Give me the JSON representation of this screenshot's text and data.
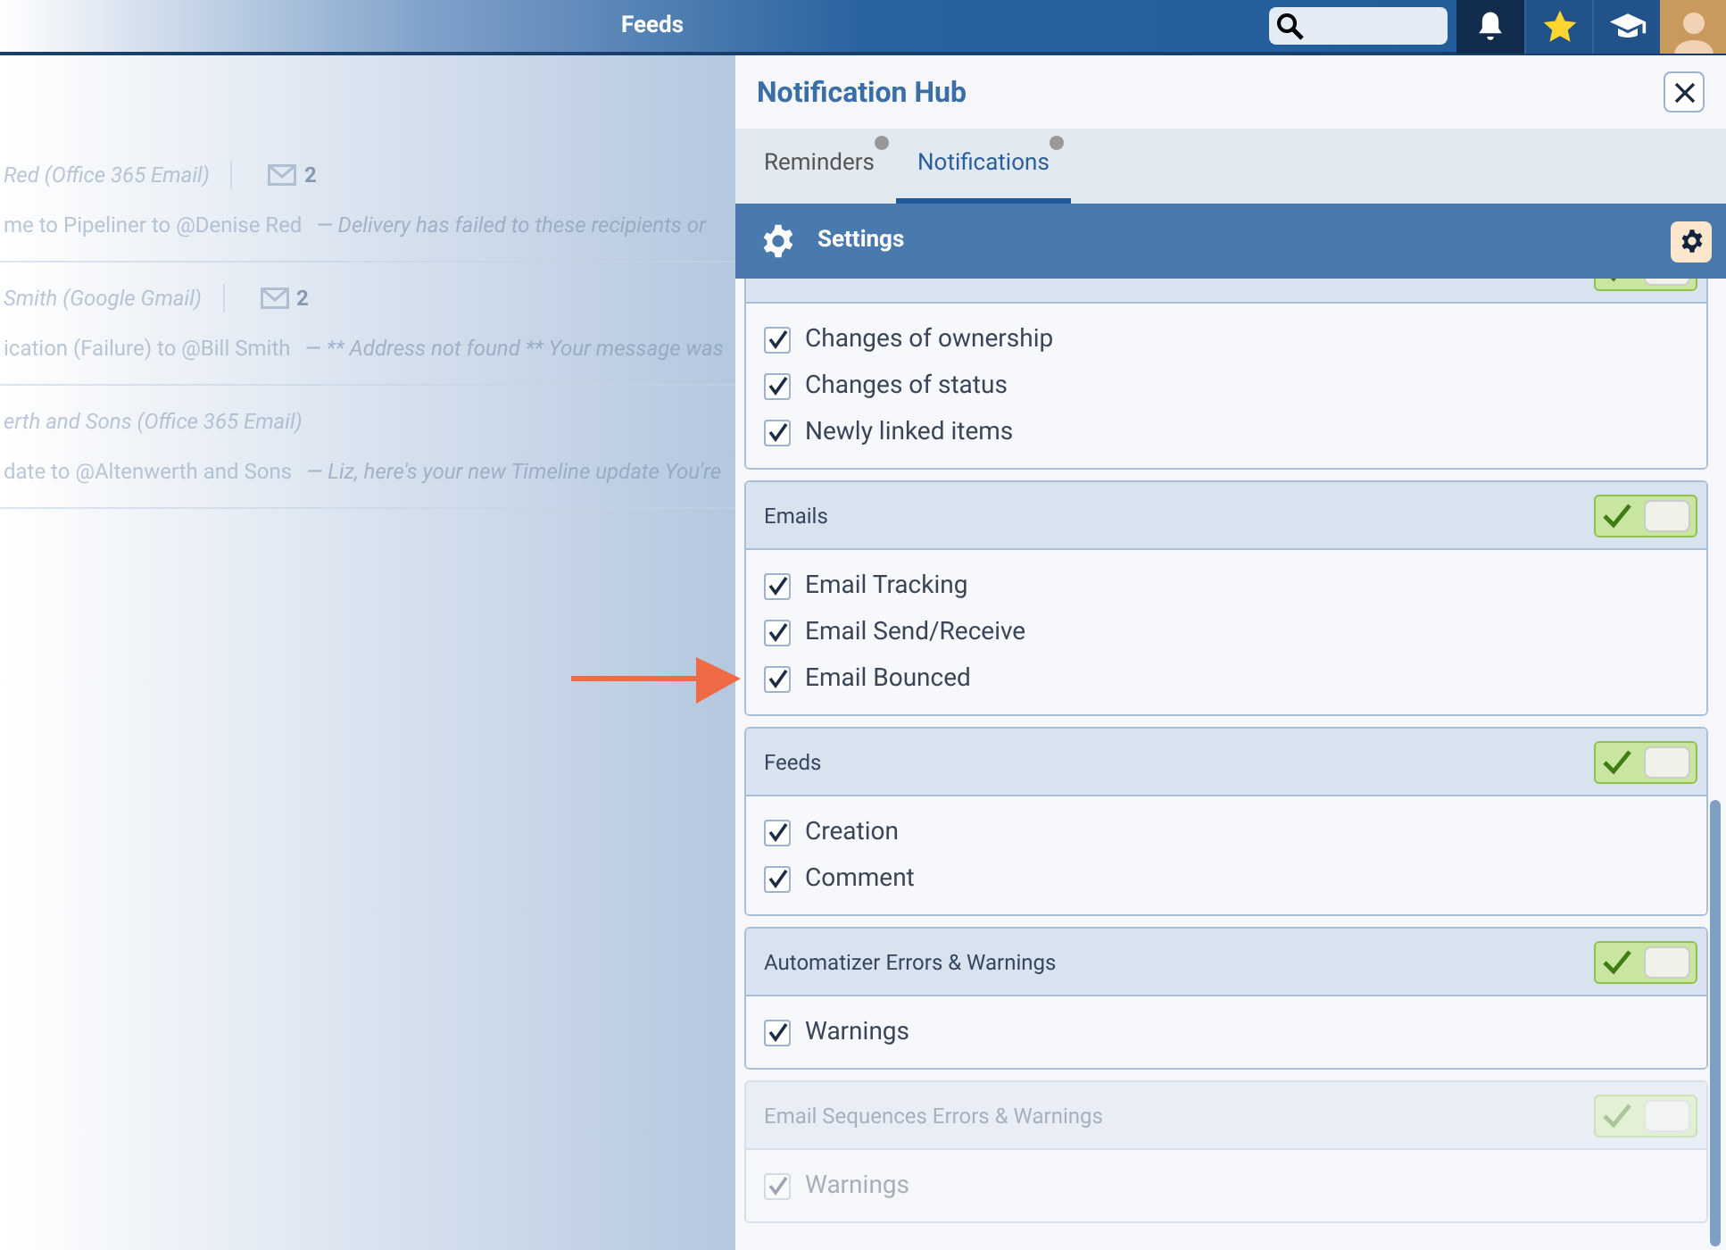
{
  "top_bar": {
    "title": "Feeds",
    "icons": [
      {
        "kind": "bell",
        "selected": true
      },
      {
        "kind": "star",
        "selected": false
      },
      {
        "kind": "cap",
        "selected": false
      }
    ]
  },
  "feed": [
    {
      "sender": "Red (Office 365 Email)",
      "count": "2",
      "line": "me to Pipeliner to @Denise Red",
      "snippet": "— Delivery has failed to these recipients or"
    },
    {
      "sender": "Smith (Google Gmail)",
      "count": "2",
      "line": "ication (Failure) to @Bill Smith",
      "snippet": "— ** Address not found ** Your message was"
    },
    {
      "sender": "erth and Sons (Office 365 Email)",
      "line": "date to @Altenwerth and Sons",
      "snippet": "— Liz, here's your new Timeline update You're"
    }
  ],
  "panel": {
    "title": "Notification Hub",
    "tabs": [
      {
        "label": "Reminders",
        "selected": false
      },
      {
        "label": "Notifications",
        "selected": true
      }
    ],
    "settings_label": "Settings",
    "sections": [
      {
        "on": true,
        "dimmed": false,
        "items": [
          {
            "label": "Changes of ownership",
            "checked": true
          },
          {
            "label": "Changes of status",
            "checked": true
          },
          {
            "label": "Newly linked items",
            "checked": true
          }
        ]
      },
      {
        "title": "Emails",
        "on": true,
        "dimmed": false,
        "items": [
          {
            "label": "Email Tracking",
            "checked": true
          },
          {
            "label": "Email Send/Receive",
            "checked": true
          },
          {
            "label": "Email Bounced",
            "checked": true
          }
        ]
      },
      {
        "title": "Feeds",
        "on": true,
        "dimmed": false,
        "items": [
          {
            "label": "Creation",
            "checked": true
          },
          {
            "label": "Comment",
            "checked": true
          }
        ]
      },
      {
        "title": "Automatizer Errors & Warnings",
        "on": true,
        "dimmed": false,
        "items": [
          {
            "label": "Warnings",
            "checked": true
          }
        ]
      },
      {
        "title": "Email Sequences Errors & Warnings",
        "on": true,
        "dimmed": true,
        "items": [
          {
            "label": "Warnings",
            "checked": true
          }
        ]
      }
    ]
  }
}
